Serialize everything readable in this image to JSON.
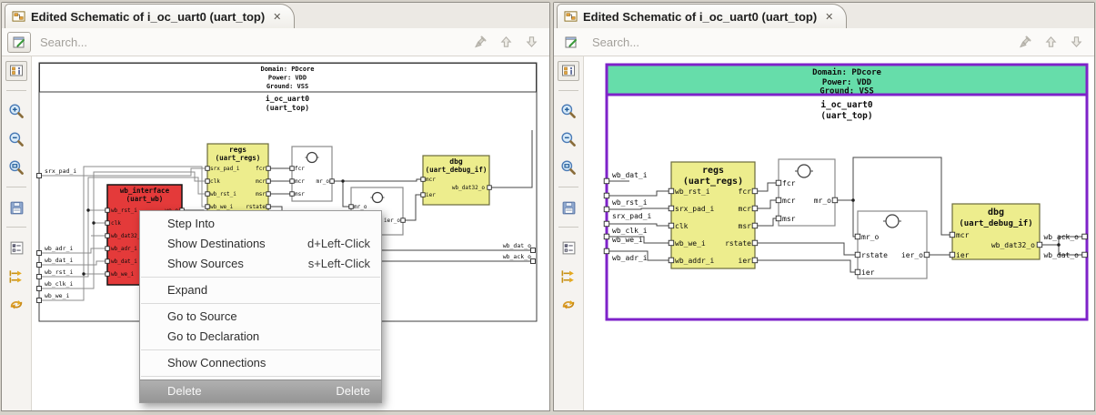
{
  "tab": {
    "title": "Edited Schematic of i_oc_uart0 (uart_top)",
    "close_glyph": "✕"
  },
  "search": {
    "placeholder": "Search..."
  },
  "toolbar": {
    "buttons": [
      "schematic-properties",
      "zoom-in",
      "zoom-out",
      "zoom-fit",
      "save",
      "display-options",
      "trace-signals",
      "swap-arrows"
    ]
  },
  "colors": {
    "domain_green": "#66DDAA",
    "selected_purple": "#7E22C9",
    "block_yellow": "#EDED8D",
    "block_red": "#E43A3A",
    "menu_highlight": "#9D9D9D"
  },
  "schematic_header": {
    "domain": "Domain: PDcore",
    "power": "Power: VDD",
    "ground": "Ground: VSS",
    "instance": "i_oc_uart0",
    "module": "(uart_top)"
  },
  "left_schematic": {
    "inputs": [
      "srx_pad_i",
      "wb_adr_i",
      "wb_dat_i",
      "wb_rst_i",
      "wb_clk_i",
      "wb_we_i"
    ],
    "outputs": [
      "wb_dat_o",
      "wb_ack_o"
    ],
    "blocks": {
      "wb_interface": {
        "name": "wb_interface",
        "module": "(uart_wb)",
        "inputs": [
          "wb_rst_i",
          "clk",
          "wb_dat32_o",
          "wb_adr_i",
          "wb_dat_i",
          "wb_we_i"
        ],
        "outputs": [
          "we_o"
        ]
      },
      "regs": {
        "name": "regs",
        "module": "(uart_regs)",
        "inputs": [
          "srx_pad_i",
          "clk",
          "wb_rst_i",
          "wb_we_i"
        ],
        "outputs": [
          "fcr",
          "mcr",
          "msr",
          "rstate"
        ]
      },
      "logic1": {
        "inputs": [
          "fcr",
          "mcr",
          "msr"
        ],
        "outputs": [
          "mr_o"
        ]
      },
      "logic2": {
        "inputs": [
          "mr_o"
        ],
        "outputs": [
          "ier_o"
        ]
      },
      "dbg": {
        "name": "dbg",
        "module": "(uart_debug_if)",
        "inputs": [
          "mcr",
          "ier"
        ],
        "outputs": [
          "wb_dat32_o"
        ]
      }
    }
  },
  "right_schematic": {
    "inputs": [
      "wb_dat_i",
      "wb_rst_i",
      "srx_pad_i",
      "wb_clk_i",
      "wb_we_i",
      "wb_adr_i"
    ],
    "outputs": [
      "wb_ack_o",
      "wb_dat_o"
    ],
    "blocks": {
      "regs": {
        "name": "regs",
        "module": "(uart_regs)",
        "inputs": [
          "wb_rst_i",
          "srx_pad_i",
          "clk",
          "wb_we_i",
          "wb_addr_i"
        ],
        "outputs": [
          "fcr",
          "mcr",
          "msr",
          "rstate",
          "ier"
        ]
      },
      "logic1": {
        "inputs": [
          "fcr",
          "mcr",
          "msr"
        ],
        "outputs": [
          "mr_o"
        ]
      },
      "logic2": {
        "inputs": [
          "mr_o",
          "rstate",
          "ier"
        ],
        "outputs": [
          "ier_o"
        ]
      },
      "dbg": {
        "name": "dbg",
        "module": "(uart_debug_if)",
        "inputs": [
          "mcr",
          "ier"
        ],
        "outputs": [
          "wb_dat32_o"
        ]
      }
    }
  },
  "context_menu": {
    "items": [
      {
        "label": "Step Into",
        "shortcut": ""
      },
      {
        "label": "Show Destinations",
        "shortcut": "d+Left-Click"
      },
      {
        "label": "Show Sources",
        "shortcut": "s+Left-Click"
      },
      {
        "label": "Expand",
        "shortcut": ""
      },
      {
        "label": "Go to Source",
        "shortcut": ""
      },
      {
        "label": "Go to Declaration",
        "shortcut": ""
      },
      {
        "label": "Show Connections",
        "shortcut": ""
      },
      {
        "label": "Delete",
        "shortcut": "Delete"
      }
    ]
  }
}
